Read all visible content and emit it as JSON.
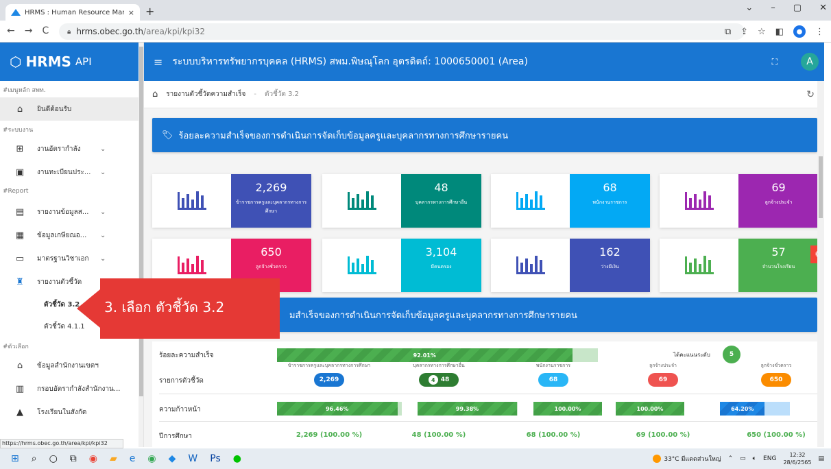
{
  "browser": {
    "tab_title": "HRMS : Human Resource Manag",
    "tab_close": "×",
    "new_tab": "+",
    "url_host": "hrms.obec.go.th",
    "url_path": "/area/kpi/kpi32",
    "status_url": "https://hrms.obec.go.th/area/kpi/kpi32"
  },
  "sidebar": {
    "brand": "HRMS",
    "brand_api": "API",
    "section1": "#เมนูหลัก สพท.",
    "home": "ยินดีต้อนรับ",
    "section2": "#ระบบงาน",
    "item_workforce": "งานอัตรากำลัง",
    "item_registry": "งานทะเบียนประ...",
    "section3": "#Report",
    "item_report_data": "รายงานข้อมูลส...",
    "item_retire": "ข้อมูลเกษียณอ...",
    "item_standard": "มาตรฐานวิชาเอก",
    "item_kpi": "รายงานตัวชี้วัด",
    "sub_kpi32": "ตัวชี้วัด 3.2",
    "sub_kpi411": "ตัวชี้วัด 4.1.1",
    "section4": "#ตัวเลือก",
    "item_office": "ข้อมูลสำนักงานเขตฯ",
    "item_frame": "กรอบอัตรากำลังสำนักงาน...",
    "item_schools": "โรงเรียนในสังกัด"
  },
  "topbar": {
    "title": "ระบบบริหารทรัพยากรบุคคล (HRMS) สพม.พิษณุโลก อุตรดิตถ์: 1000650001 (Area)",
    "avatar": "A"
  },
  "breadcrumb": {
    "parent": "รายงานตัวชี้วัดความสำเร็จ",
    "sep": "-",
    "current": "ตัวชี้วัด 3.2"
  },
  "banner1": "ร้อยละความสำเร็จของการดำเนินการจัดเก็บข้อมูลครูและบุคลากรทางการศึกษารายคน",
  "banner2": "มสำเร็จของการดำเนินการจัดเก็บข้อมูลครูและบุคลากรทางการศึกษารายคน",
  "cards": [
    {
      "value": "2,269",
      "label": "ข้าราชการครูและบุคลากรทางการศึกษา",
      "color": "#3f51b5",
      "icon_color": "#3f51b5"
    },
    {
      "value": "48",
      "label": "บุคลากรทางการศึกษาอื่น",
      "color": "#00897b",
      "icon_color": "#00897b"
    },
    {
      "value": "68",
      "label": "พนักงานราชการ",
      "color": "#03a9f4",
      "icon_color": "#03a9f4"
    },
    {
      "value": "69",
      "label": "ลูกจ้างประจำ",
      "color": "#9c27b0",
      "icon_color": "#9c27b0"
    },
    {
      "value": "650",
      "label": "ลูกจ้างชั่วคราว",
      "color": "#e91e63",
      "icon_color": "#e91e63"
    },
    {
      "value": "3,104",
      "label": "มีคนครอง",
      "color": "#00bcd4",
      "icon_color": "#00bcd4"
    },
    {
      "value": "162",
      "label": "ว่างมีเงิน",
      "color": "#3f51b5",
      "icon_color": "#3f51b5"
    },
    {
      "value": "57",
      "label": "จำนวนโรงเรียน",
      "color": "#4caf50",
      "icon_color": "#4caf50"
    }
  ],
  "annotation": "3. เลือก ตัวชี้วัด 3.2",
  "table": {
    "success_label": "ร้อยละความสำเร็จ",
    "success_value": "92.01%",
    "success_fraction": 0.9201,
    "level_label": "ได้คะแนนระดับ",
    "level_value": "5",
    "kpi_label": "รายการตัวชี้วัด",
    "progress_label": "ความก้าวหน้า",
    "year_label": "ปีการศึกษา",
    "columns": [
      {
        "header": "ข้าราชการครูและบุคลากรทางการศึกษา",
        "count": "2,269",
        "badge_color": "#1976d2",
        "progress": "96.46%",
        "progress_fraction": 0.9646,
        "year": "2,269 (100.00 %)"
      },
      {
        "header": "บุคลากรทางการศึกษาอื่น",
        "count": "48",
        "badge_prefix": "4",
        "badge_color": "#2e7d32",
        "progress": "99.38%",
        "progress_fraction": 0.9938,
        "year": "48 (100.00 %)"
      },
      {
        "header": "พนักงานราชการ",
        "count": "68",
        "badge_color": "#29b6f6",
        "progress": "100.00%",
        "progress_fraction": 1.0,
        "year": "68 (100.00 %)"
      },
      {
        "header": "ลูกจ้างประจำ",
        "count": "69",
        "badge_color": "#ef5350",
        "progress": "100.00%",
        "progress_fraction": 1.0,
        "year": "69 (100.00 %)"
      },
      {
        "header": "ลูกจ้างชั่วคราว",
        "count": "650",
        "badge_color": "#fb8c00",
        "progress": "64.20%",
        "progress_fraction": 0.642,
        "year": "650 (100.00 %)"
      }
    ]
  },
  "taskbar": {
    "weather": "33°C มีแดดส่วนใหญ่",
    "lang": "ENG",
    "time": "12:32",
    "date": "28/6/2565"
  }
}
